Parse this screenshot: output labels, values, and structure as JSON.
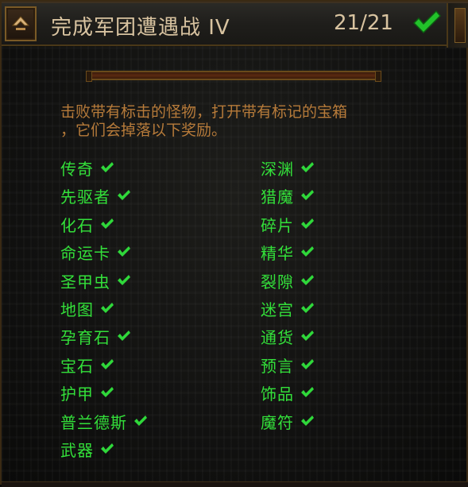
{
  "header": {
    "title": "完成军团遭遇战 IV",
    "progress": "21/21"
  },
  "description": {
    "line1": "击败带有标击的怪物，打开带有标记的宝箱",
    "line2": "，它们会掉落以下奖励。"
  },
  "rewards": {
    "left": [
      "传奇",
      "先驱者",
      "化石",
      "命运卡",
      "圣甲虫",
      "地图",
      "孕育石",
      "宝石",
      "护甲",
      "普兰德斯",
      "武器"
    ],
    "right": [
      "深渊",
      "猎魔",
      "碎片",
      "精华",
      "裂隙",
      "迷宫",
      "通货",
      "预言",
      "饰品",
      "魔符"
    ]
  },
  "colors": {
    "title": "#d8c3a0",
    "description": "#b77b3a",
    "reward": "#33e03a",
    "check": "#2fd83a"
  },
  "icons": {
    "collapse": "chevron-up-icon",
    "complete": "checkmark-icon"
  }
}
